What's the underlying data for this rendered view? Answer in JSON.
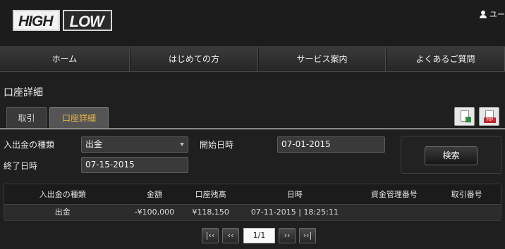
{
  "header": {
    "logo_high": "HIGH",
    "logo_low": "LOW",
    "user_label": "ユー"
  },
  "nav": {
    "items": [
      {
        "label": "ホーム"
      },
      {
        "label": "はじめての方"
      },
      {
        "label": "サービス案内"
      },
      {
        "label": "よくあるご質問"
      }
    ]
  },
  "page": {
    "title": "口座詳細"
  },
  "tabs": [
    {
      "label": "取引",
      "active": false
    },
    {
      "label": "口座詳細",
      "active": true
    }
  ],
  "export": {
    "excel_icon": "excel-export-icon",
    "pdf_icon": "pdf-export-icon",
    "pdf_text": "PDF"
  },
  "filter": {
    "type_label": "入出金の種類",
    "type_value": "出金",
    "start_label": "開始日時",
    "start_value": "07-01-2015",
    "end_label": "終了日時",
    "end_value": "07-15-2015",
    "search_label": "検索"
  },
  "table": {
    "headers": [
      "入出金の種類",
      "金額",
      "口座残高",
      "日時",
      "資金管理番号",
      "取引番号"
    ],
    "rows": [
      [
        "出金",
        "-¥100,000",
        "¥118,150",
        "07-11-2015 | 18:25:11",
        "",
        ""
      ]
    ]
  },
  "pagination": {
    "first": "|‹‹",
    "prev": "‹‹",
    "page": "1/1",
    "next": "››",
    "last": "››|"
  },
  "colors": {
    "accent": "#e8b84a",
    "background": "#1f1f1f"
  }
}
